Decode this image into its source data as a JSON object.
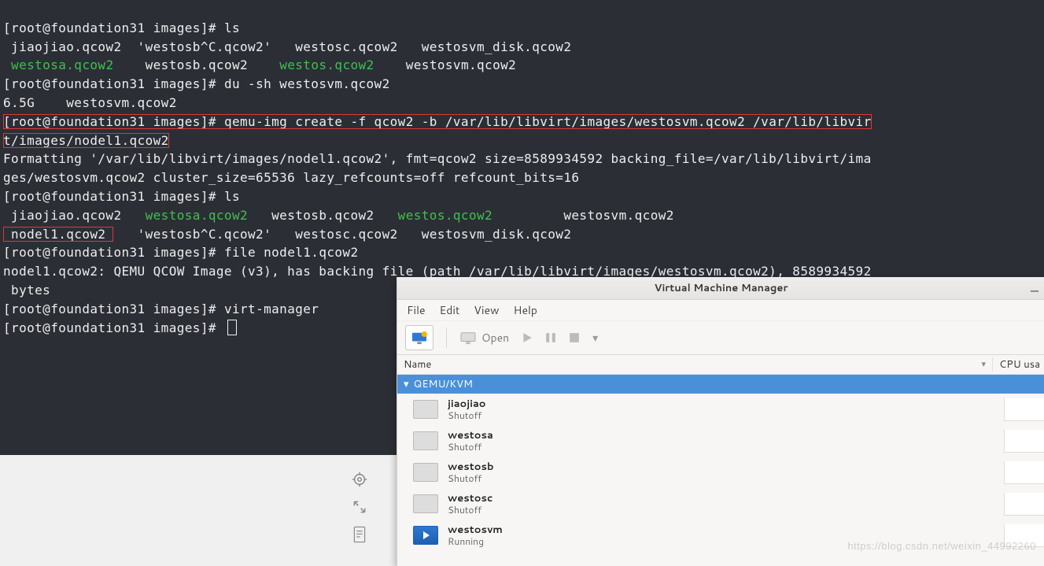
{
  "terminal": {
    "prompt": "[root@foundation31 images]#",
    "cmd_ls1": "ls",
    "line1a": " jiaojiao.qcow2  'westosb^C.qcow2'   westosc.qcow2   westosvm_disk.qcow2",
    "line1b_pre": " ",
    "line1b_g1": "westosa.qcow2",
    "line1b_mid1": "    westosb.qcow2    ",
    "line1b_g2": "westos.qcow2",
    "line1b_tail": "    westosvm.qcow2",
    "cmd_du": "du -sh westosvm.qcow2",
    "du_out": "6.5G    westosvm.qcow2",
    "cmd_qemu_p1": "qemu-img create -f qcow2 -b /var/lib/libvirt/images/westosvm.qcow2 /var/lib/libvir",
    "cmd_qemu_p2": "t/images/nodel1.qcow2",
    "fmt1": "Formatting '/var/lib/libvirt/images/nodel1.qcow2', fmt=qcow2 size=8589934592 backing_file=/var/lib/libvirt/ima",
    "fmt2": "ges/westosvm.qcow2 cluster_size=65536 lazy_refcounts=off refcount_bits=16",
    "ls2_a": " jiaojiao.qcow2   ",
    "ls2_g1": "westosa.qcow2",
    "ls2_mid1": "   westosb.qcow2   ",
    "ls2_g2": "westos.qcow2",
    "ls2_tail1": "         westosvm.qcow2",
    "ls2_b_box": " nodel1.qcow2 ",
    "ls2_b_rest": "   'westosb^C.qcow2'   westosc.qcow2   westosvm_disk.qcow2",
    "cmd_file": "file nodel1.qcow2",
    "file_out1": "nodel1.qcow2: QEMU QCOW Image (v3), has backing file (path /var/lib/libvirt/images/westosvm.qcow2), 8589934592",
    "file_out2": " bytes",
    "cmd_vm": "virt-manager"
  },
  "vmm": {
    "title": "Virtual Machine Manager",
    "menu": {
      "file": "File",
      "edit": "Edit",
      "view": "View",
      "help": "Help"
    },
    "toolbar": {
      "open": "Open"
    },
    "headers": {
      "name": "Name",
      "cpu": "CPU usa"
    },
    "host": "QEMU/KVM",
    "vms": [
      {
        "name": "jiaojiao",
        "status": "Shutoff",
        "running": false
      },
      {
        "name": "westosa",
        "status": "Shutoff",
        "running": false
      },
      {
        "name": "westosb",
        "status": "Shutoff",
        "running": false
      },
      {
        "name": "westosc",
        "status": "Shutoff",
        "running": false
      },
      {
        "name": "westosvm",
        "status": "Running",
        "running": true
      }
    ]
  },
  "watermark": "https://blog.csdn.net/weixin_44992260"
}
